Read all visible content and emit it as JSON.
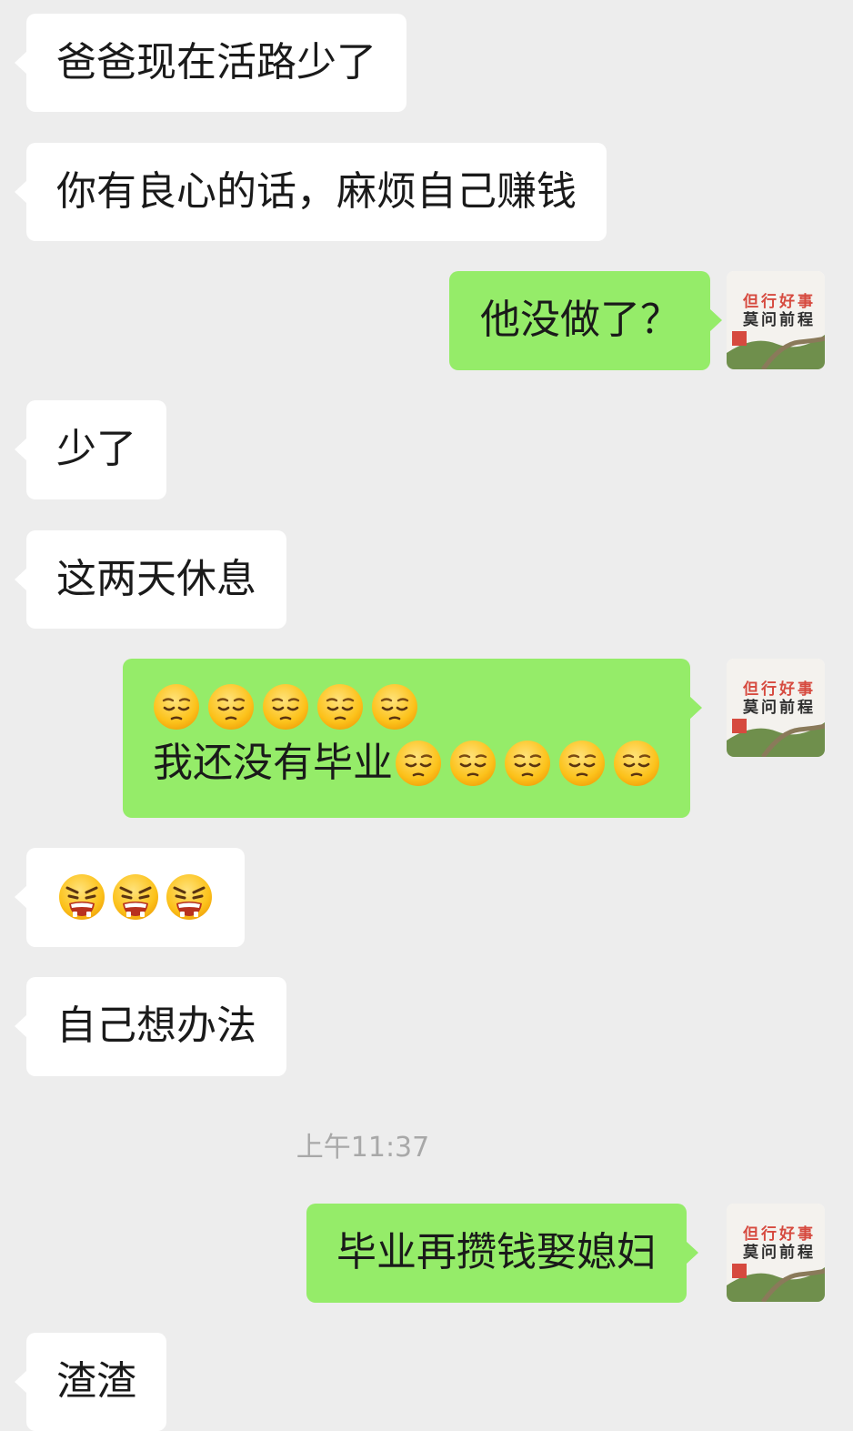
{
  "messages": [
    {
      "from": "other",
      "text": "爸爸现在活路少了"
    },
    {
      "from": "other",
      "text": "你有良心的话，麻烦自己赚钱"
    },
    {
      "from": "me",
      "text": "他没做了？"
    },
    {
      "from": "other",
      "text": "少了"
    },
    {
      "from": "other",
      "text": "这两天休息"
    },
    {
      "from": "me",
      "emoji_line": [
        "pensive-emoji",
        "pensive-emoji",
        "pensive-emoji",
        "pensive-emoji",
        "pensive-emoji"
      ],
      "text": "我还没有毕业",
      "trailing_emoji": [
        "pensive-emoji",
        "pensive-emoji",
        "pensive-emoji",
        "pensive-emoji",
        "pensive-emoji"
      ]
    },
    {
      "from": "other",
      "emoji": [
        "angry-emoji",
        "angry-emoji",
        "angry-emoji"
      ]
    },
    {
      "from": "other",
      "text": "自己想办法"
    },
    {
      "from": "me",
      "text": "毕业再攒钱娶媳妇"
    },
    {
      "from": "other",
      "text": "渣渣"
    }
  ],
  "timestamp": "上午11:37",
  "avatar": {
    "icon": "great-wall-avatar-icon",
    "line1": "但行好事",
    "line2": "莫问前程"
  },
  "colors": {
    "background": "#ededed",
    "incoming_bubble": "#ffffff",
    "outgoing_bubble": "#95ec69",
    "timestamp": "#a8a8a8"
  }
}
